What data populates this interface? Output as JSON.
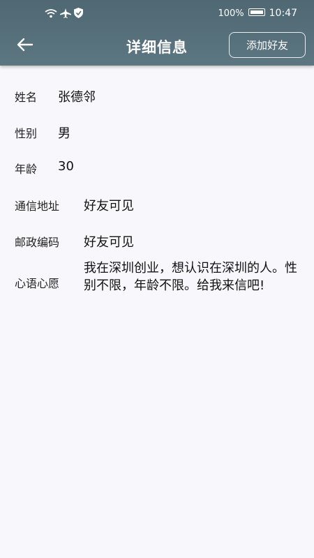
{
  "status_bar": {
    "battery_percent": "100%",
    "time": "10:47",
    "icons": [
      "wifi-icon",
      "airplane-icon",
      "shield-icon",
      "battery-icon"
    ]
  },
  "toolbar": {
    "back_icon": "back-arrow-icon",
    "title": "详细信息",
    "add_friend_label": "添加好友"
  },
  "profile": {
    "name_label": "姓名",
    "name_value": "张德邻",
    "gender_label": "性别",
    "gender_value": "男",
    "age_label": "年龄",
    "age_value": "30",
    "address_label": "通信地址",
    "address_value": "好友可见",
    "postcode_label": "邮政编码",
    "postcode_value": "好友可见",
    "wish_label": "心语心愿",
    "wish_value": "我在深圳创业，想认识在深圳的人。性别不限，年龄不限。给我来信吧!"
  },
  "colors": {
    "header_bg": "#556f7a",
    "page_bg": "#f8f7fb",
    "text": "#111111"
  }
}
